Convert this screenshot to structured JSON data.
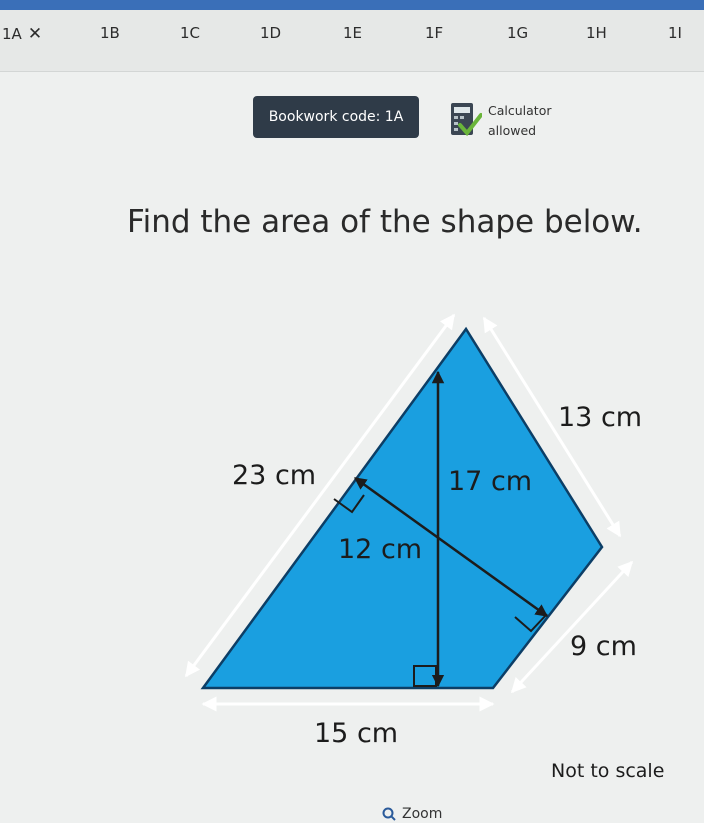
{
  "tabs": [
    {
      "label": "1A",
      "close": "✕"
    },
    {
      "label": "1B"
    },
    {
      "label": "1C"
    },
    {
      "label": "1D"
    },
    {
      "label": "1E"
    },
    {
      "label": "1F"
    },
    {
      "label": "1G"
    },
    {
      "label": "1H"
    },
    {
      "label": "1I"
    }
  ],
  "bookwork_code": "Bookwork code: 1A",
  "calculator": {
    "line1": "Calculator",
    "line2": "allowed",
    "icon": "calculator-icon"
  },
  "question": "Find the area of the shape below.",
  "diagram": {
    "label_slant_left": "23 cm",
    "label_slant_right": "13 cm",
    "label_height": "17 cm",
    "label_perp": "12 cm",
    "label_right_lower": "9 cm",
    "label_base": "15 cm",
    "fill_color": "#1a9fe0"
  },
  "scale_note": "Not to scale",
  "zoom_label": "Zoom",
  "colors": {
    "tab_bar": "#e6e8e7",
    "bookwork_bg": "#2f3b48",
    "top_strip": "#3a6fb8"
  }
}
